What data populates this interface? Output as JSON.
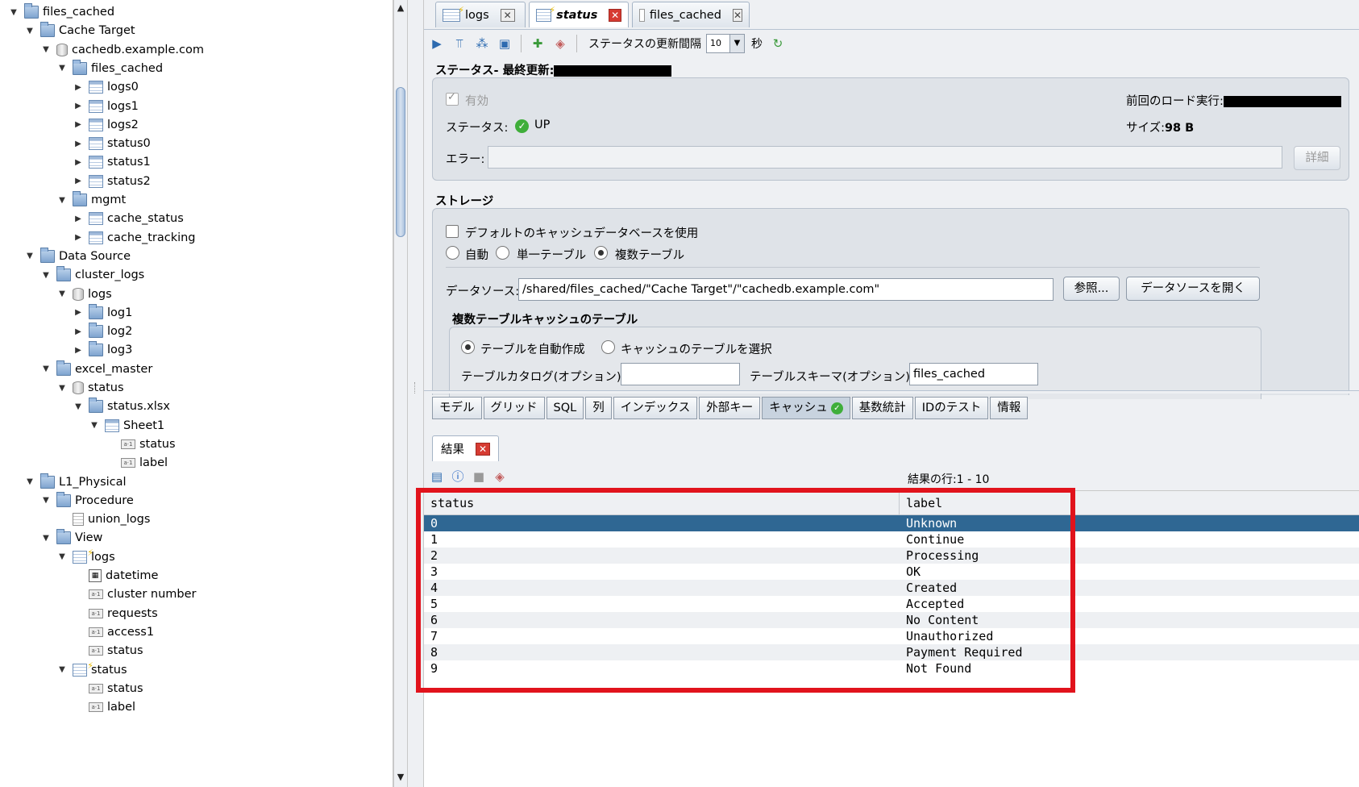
{
  "tree": [
    {
      "label": "files_cached",
      "level": 0,
      "icon": "folder",
      "toggle": "open"
    },
    {
      "label": "Cache Target",
      "level": 1,
      "icon": "folder",
      "toggle": "open"
    },
    {
      "label": "cachedb.example.com",
      "level": 2,
      "icon": "db",
      "toggle": "open"
    },
    {
      "label": "files_cached",
      "level": 3,
      "icon": "folder",
      "toggle": "open"
    },
    {
      "label": "logs0",
      "level": 4,
      "icon": "table",
      "toggle": "closed"
    },
    {
      "label": "logs1",
      "level": 4,
      "icon": "table",
      "toggle": "closed"
    },
    {
      "label": "logs2",
      "level": 4,
      "icon": "table",
      "toggle": "closed"
    },
    {
      "label": "status0",
      "level": 4,
      "icon": "table",
      "toggle": "closed"
    },
    {
      "label": "status1",
      "level": 4,
      "icon": "table",
      "toggle": "closed"
    },
    {
      "label": "status2",
      "level": 4,
      "icon": "table",
      "toggle": "closed"
    },
    {
      "label": "mgmt",
      "level": 3,
      "icon": "folder",
      "toggle": "open"
    },
    {
      "label": "cache_status",
      "level": 4,
      "icon": "table",
      "toggle": "closed"
    },
    {
      "label": "cache_tracking",
      "level": 4,
      "icon": "table",
      "toggle": "closed"
    },
    {
      "label": "Data Source",
      "level": 1,
      "icon": "folder",
      "toggle": "open"
    },
    {
      "label": "cluster_logs",
      "level": 2,
      "icon": "folder",
      "toggle": "open"
    },
    {
      "label": "logs",
      "level": 3,
      "icon": "db",
      "toggle": "open"
    },
    {
      "label": "log1",
      "level": 4,
      "icon": "folder",
      "toggle": "closed"
    },
    {
      "label": "log2",
      "level": 4,
      "icon": "folder",
      "toggle": "closed"
    },
    {
      "label": "log3",
      "level": 4,
      "icon": "folder",
      "toggle": "closed"
    },
    {
      "label": "excel_master",
      "level": 2,
      "icon": "folder",
      "toggle": "open"
    },
    {
      "label": "status",
      "level": 3,
      "icon": "db",
      "toggle": "open"
    },
    {
      "label": "status.xlsx",
      "level": 4,
      "icon": "folder",
      "toggle": "open"
    },
    {
      "label": "Sheet1",
      "level": 5,
      "icon": "table",
      "toggle": "open"
    },
    {
      "label": "status",
      "level": 6,
      "icon": "col",
      "toggle": "none"
    },
    {
      "label": "label",
      "level": 6,
      "icon": "col",
      "toggle": "none"
    },
    {
      "label": "L1_Physical",
      "level": 1,
      "icon": "folder",
      "toggle": "open"
    },
    {
      "label": "Procedure",
      "level": 2,
      "icon": "folder",
      "toggle": "open"
    },
    {
      "label": "union_logs",
      "level": 3,
      "icon": "doc",
      "toggle": "none"
    },
    {
      "label": "View",
      "level": 2,
      "icon": "folder",
      "toggle": "open"
    },
    {
      "label": "logs",
      "level": 3,
      "icon": "view",
      "toggle": "open"
    },
    {
      "label": "datetime",
      "level": 4,
      "icon": "cal",
      "toggle": "none"
    },
    {
      "label": "cluster number",
      "level": 4,
      "icon": "col",
      "toggle": "none"
    },
    {
      "label": "requests",
      "level": 4,
      "icon": "col",
      "toggle": "none"
    },
    {
      "label": "access1",
      "level": 4,
      "icon": "col",
      "toggle": "none"
    },
    {
      "label": "status",
      "level": 4,
      "icon": "col",
      "toggle": "none"
    },
    {
      "label": "status",
      "level": 3,
      "icon": "view",
      "toggle": "open"
    },
    {
      "label": "status",
      "level": 4,
      "icon": "col",
      "toggle": "none"
    },
    {
      "label": "label",
      "level": 4,
      "icon": "col",
      "toggle": "none"
    }
  ],
  "tabs": {
    "logs": "logs",
    "status": "status",
    "files_cached": "files_cached",
    "close": "✕"
  },
  "toolbar": {
    "refresh_label": "ステータスの更新間隔",
    "refresh_value": "10",
    "refresh_unit": "秒"
  },
  "status_section": {
    "title": "ステータス- 最終更新:",
    "enabled_label": "有効",
    "status_label": "ステータス:",
    "status_value": "UP",
    "error_label": "エラー:",
    "error_value": "",
    "detail_button": "詳細",
    "last_load_label": "前回のロード実行:",
    "size_label": "サイズ:",
    "size_value": "98 B"
  },
  "storage": {
    "title": "ストレージ",
    "use_default_label": "デフォルトのキャッシュデータベースを使用",
    "radio_auto": "自動",
    "radio_single": "単一テーブル",
    "radio_multi": "複数テーブル",
    "datasource_label": "データソース:",
    "datasource_value": "/shared/files_cached/\"Cache Target\"/\"cachedb.example.com\"",
    "browse_button": "参照...",
    "open_button": "データソースを開く",
    "multi_title": "複数テーブルキャッシュのテーブル",
    "radio_auto_create": "テーブルを自動作成",
    "radio_select": "キャッシュのテーブルを選択",
    "catalog_label": "テーブルカタログ(オプション)",
    "catalog_value": "",
    "schema_label": "テーブルスキーマ(オプション)",
    "schema_value": "files_cached"
  },
  "bottom_tabs": [
    "モデル",
    "グリッド",
    "SQL",
    "列",
    "インデックス",
    "外部キー",
    "キャッシュ",
    "基数統計",
    "IDのテスト",
    "情報"
  ],
  "result": {
    "tab_label": "結果",
    "rows_info": "結果の行:1 - 10",
    "columns": [
      "status",
      "label"
    ],
    "rows": [
      [
        "0",
        "Unknown"
      ],
      [
        "1",
        "Continue"
      ],
      [
        "2",
        "Processing"
      ],
      [
        "3",
        "OK"
      ],
      [
        "4",
        "Created"
      ],
      [
        "5",
        "Accepted"
      ],
      [
        "6",
        "No Content"
      ],
      [
        "7",
        "Unauthorized"
      ],
      [
        "8",
        "Payment Required"
      ],
      [
        "9",
        "Not Found"
      ]
    ]
  },
  "colors": {
    "selected_row": "#2f6793",
    "highlight_border": "#e1131c",
    "status_ok": "#3fae3a"
  }
}
